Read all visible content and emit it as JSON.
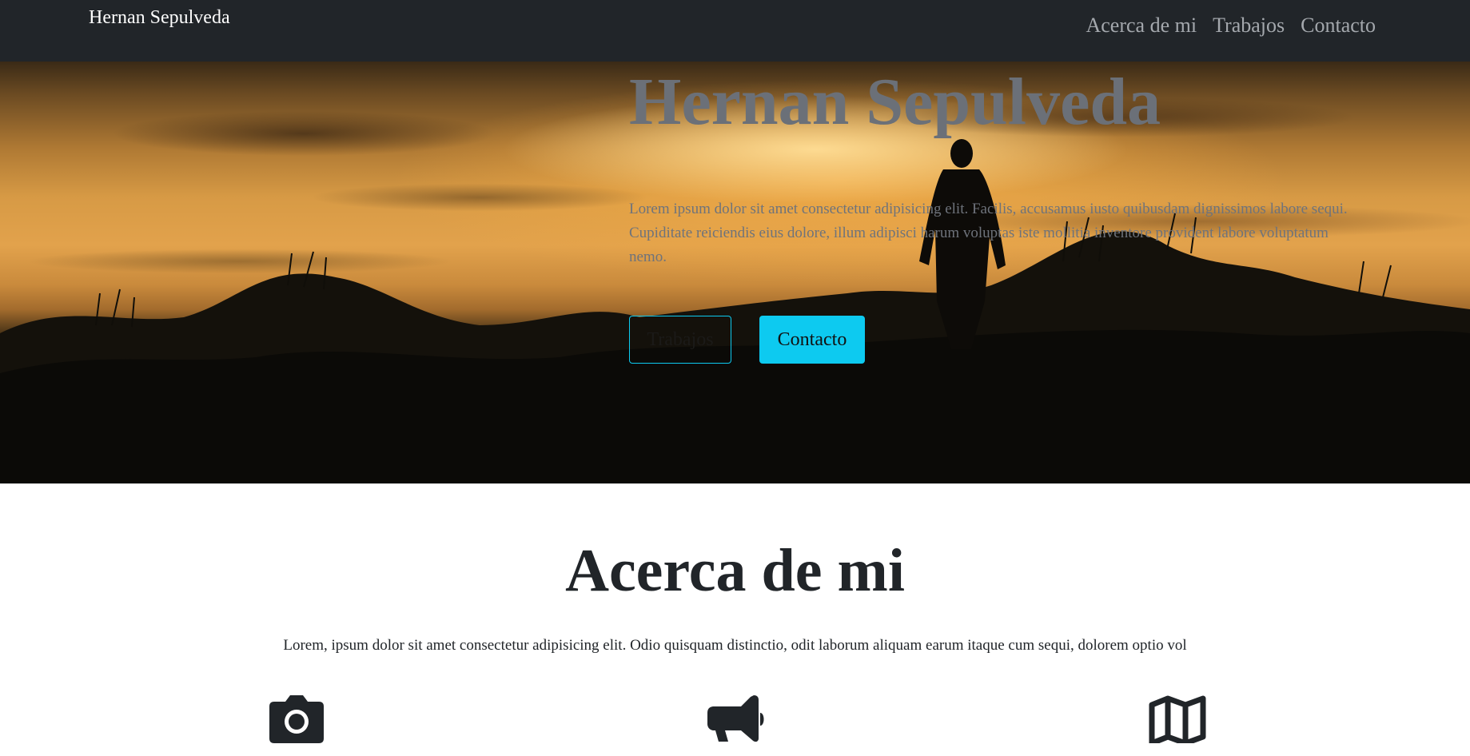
{
  "navbar": {
    "brand": "Hernan Sepulveda",
    "links": [
      "Acerca de mi",
      "Trabajos",
      "Contacto"
    ]
  },
  "hero": {
    "title": "Hernan Sepulveda",
    "text": "Lorem ipsum dolor sit amet consectetur adipisicing elit. Facilis, accusamus iusto quibusdam dignissimos labore sequi. Cupiditate reiciendis eius dolore, illum adipisci harum voluptas iste mollitia inventore provident labore voluptatum nemo.",
    "buttons": {
      "works_label": "Trabajos",
      "contact_label": "Contacto"
    },
    "background_image": "sunset-silhouette-grass-landscape"
  },
  "about": {
    "title": "Acerca de mi",
    "text": "Lorem, ipsum dolor sit amet consectetur adipisicing elit. Odio quisquam distinctio, odit laborum aliquam earum itaque cum sequi, dolorem optio vol",
    "icons": [
      "camera-icon",
      "megaphone-icon",
      "map-icon"
    ]
  },
  "colors": {
    "navbar_bg": "#212529",
    "accent": "#0dcaf0",
    "text_dark": "#212529",
    "hero_text": "#6c757d"
  }
}
